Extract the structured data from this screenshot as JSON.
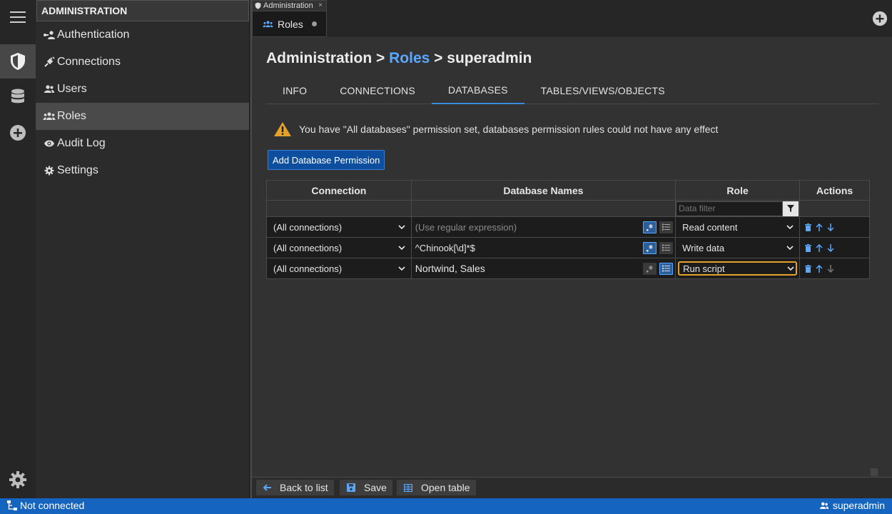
{
  "sidebar": {
    "title": "ADMINISTRATION",
    "items": [
      {
        "label": "Authentication",
        "icon": "user-key-icon"
      },
      {
        "label": "Connections",
        "icon": "plug-icon"
      },
      {
        "label": "Users",
        "icon": "users-icon"
      },
      {
        "label": "Roles",
        "icon": "roles-icon",
        "active": true
      },
      {
        "label": "Audit Log",
        "icon": "eye-icon"
      },
      {
        "label": "Settings",
        "icon": "gear-icon"
      }
    ]
  },
  "tabs": {
    "admin_label": "Administration",
    "admin_close": "×",
    "roles_label": "Roles"
  },
  "breadcrumb": {
    "part1": "Administration",
    "sep1": ">",
    "part2": "Roles",
    "sep2": ">",
    "part3": "superadmin"
  },
  "subtabs": [
    "INFO",
    "CONNECTIONS",
    "DATABASES",
    "TABLES/VIEWS/OBJECTS"
  ],
  "warning": {
    "text": "You have \"All databases\" permission set, databases permission rules could not have any effect"
  },
  "add_permission_label": "Add Database Permission",
  "table": {
    "headers": {
      "connection": "Connection",
      "database_names": "Database Names",
      "role": "Role",
      "actions": "Actions"
    },
    "role_filter_placeholder": "Data filter",
    "rows": [
      {
        "connection": "(All connections)",
        "database": "",
        "database_placeholder": "(Use regular expression)",
        "role": "Read content"
      },
      {
        "connection": "(All connections)",
        "database": "^Chinook[\\d]*$",
        "database_placeholder": "",
        "role": "Write data"
      },
      {
        "connection": "(All connections)",
        "database": "Nortwind, Sales",
        "database_placeholder": "",
        "role": "Run script"
      }
    ]
  },
  "bottom_bar": {
    "back": "Back to list",
    "save": "Save",
    "open_table": "Open table"
  },
  "status_bar": {
    "left": "Not connected",
    "right": "superadmin"
  },
  "colors": {
    "accent": "#1565c0",
    "link": "#5aa7ff",
    "warning": "#e5a22a"
  }
}
